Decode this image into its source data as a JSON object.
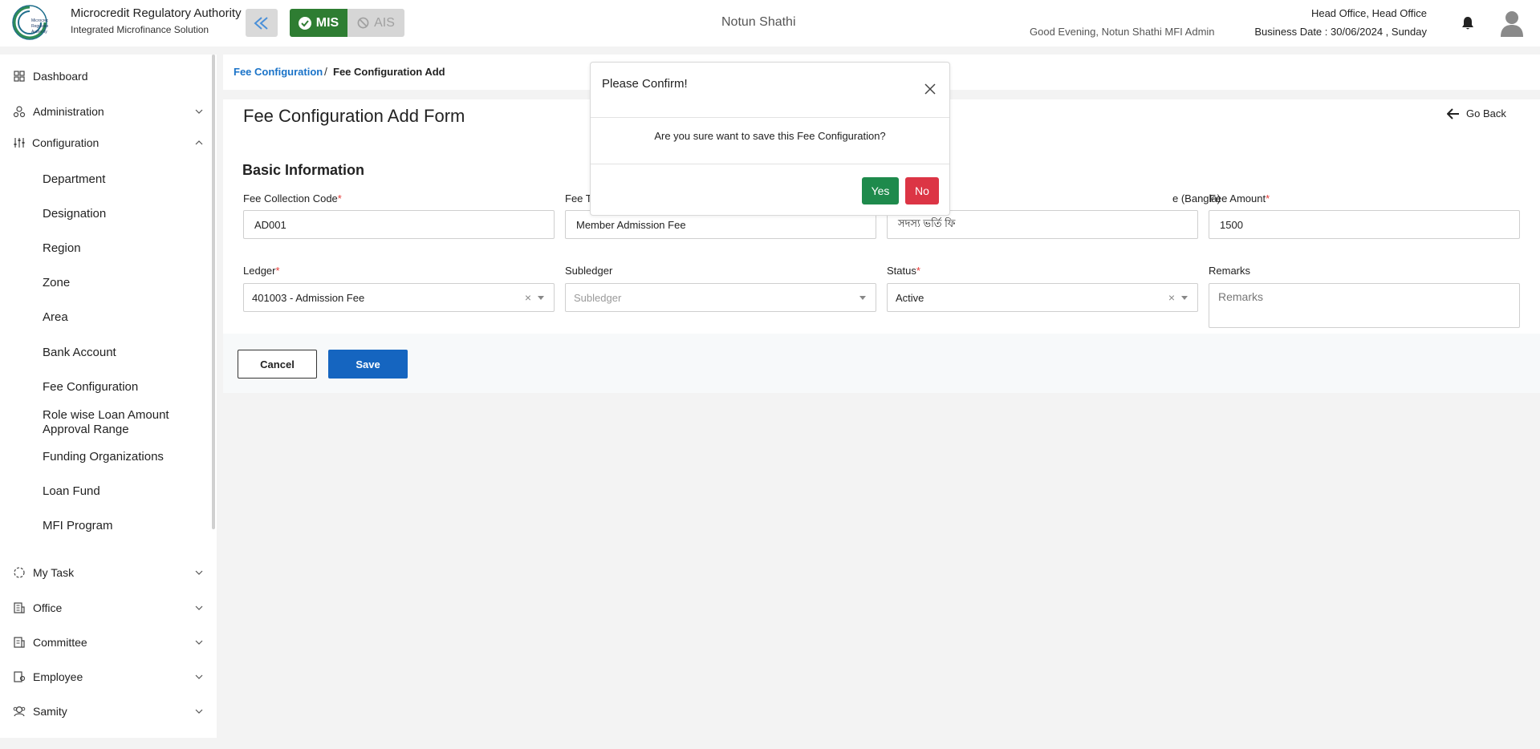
{
  "header": {
    "org_name": "Microcredit Regulatory Authority",
    "org_sub": "Integrated Microfinance Solution",
    "logo_text": "Microcredit Regulatory Authority",
    "mis_label": "MIS",
    "ais_label": "AIS",
    "center_title": "Notun Shathi",
    "greeting": "Good Evening, Notun Shathi MFI Admin",
    "office": "Head Office, Head Office",
    "business_date": "Business Date : 30/06/2024 , Sunday"
  },
  "sidebar": {
    "items": [
      {
        "label": "Dashboard",
        "icon": "grid-icon"
      },
      {
        "label": "Administration",
        "icon": "admin-icon"
      },
      {
        "label": "Configuration",
        "icon": "sliders-icon"
      }
    ],
    "sub_items": [
      "Department",
      "Designation",
      "Region",
      "Zone",
      "Area",
      "Bank Account",
      "Fee Configuration",
      "Role wise Loan Amount Approval Range",
      "Funding Organizations",
      "Loan Fund",
      "MFI Program"
    ],
    "bottom_items": [
      {
        "label": "My Task",
        "icon": "task-icon"
      },
      {
        "label": "Office",
        "icon": "office-icon"
      },
      {
        "label": "Committee",
        "icon": "committee-icon"
      },
      {
        "label": "Employee",
        "icon": "employee-icon"
      },
      {
        "label": "Samity",
        "icon": "samity-icon"
      }
    ]
  },
  "breadcrumb": {
    "link": "Fee Configuration",
    "separator": "/",
    "current": "Fee Configuration Add"
  },
  "form": {
    "title": "Fee Configuration Add Form",
    "go_back": "Go Back",
    "section": "Basic Information",
    "fields": {
      "fee_collection_code": {
        "label": "Fee Collection Code",
        "value": "AD001"
      },
      "fee_type": {
        "label": "Fee T",
        "value": "Member Admission Fee"
      },
      "fee_type_bangla": {
        "label": "e (Bangla)",
        "value": "সদস্য ভর্তি ফি"
      },
      "fee_amount": {
        "label": "Fee Amount",
        "value": "1500"
      },
      "ledger": {
        "label": "Ledger",
        "value": "401003 - Admission Fee"
      },
      "subledger": {
        "label": "Subledger",
        "placeholder": "Subledger"
      },
      "status": {
        "label": "Status",
        "value": "Active"
      },
      "remarks": {
        "label": "Remarks",
        "placeholder": "Remarks"
      }
    },
    "required_mark": "*",
    "clear_mark": "×",
    "cancel_label": "Cancel",
    "save_label": "Save"
  },
  "modal": {
    "title": "Please Confirm!",
    "message": "Are you sure want to save this Fee Configuration?",
    "yes_label": "Yes",
    "no_label": "No"
  }
}
